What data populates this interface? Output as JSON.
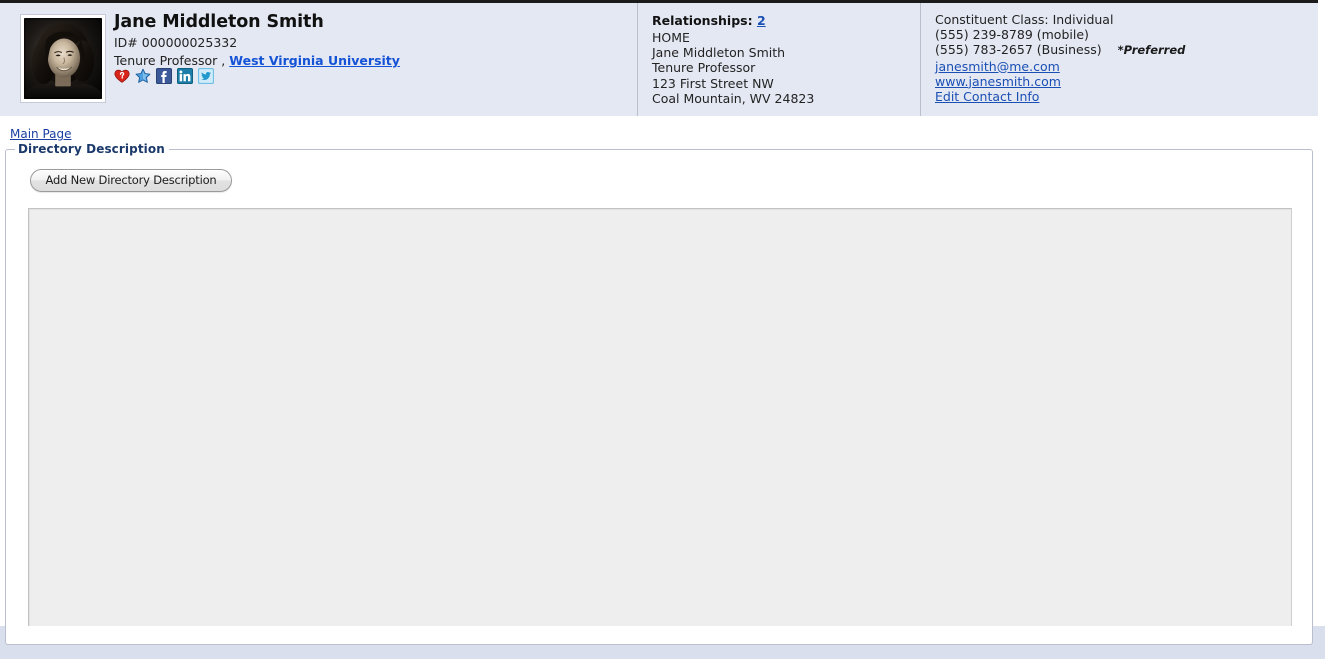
{
  "header": {
    "identity": {
      "avatar_alt": "constituent-portrait",
      "name": "Jane Middleton Smith",
      "id_label": "ID# 000000025332",
      "title": "Tenure Professor ,",
      "organization": "West Virginia University",
      "social_icons": [
        {
          "name": "heart-question-icon",
          "title": "Giving / Interest"
        },
        {
          "name": "star-icon",
          "title": "Favorite"
        },
        {
          "name": "facebook-icon",
          "title": "Facebook"
        },
        {
          "name": "linkedin-icon",
          "title": "LinkedIn"
        },
        {
          "name": "twitter-icon",
          "title": "Twitter"
        }
      ]
    },
    "relationships": {
      "heading_label": "Relationships:",
      "count": "2",
      "lines": [
        "HOME",
        "Jane Middleton Smith",
        "Tenure Professor",
        "123 First Street NW",
        "Coal Mountain, WV 24823"
      ]
    },
    "contact": {
      "constituent_class": "Constituent Class: Individual",
      "phone_mobile": "(555) 239-8789 (mobile)",
      "phone_business": "(555) 783-2657 (Business)",
      "preferred_tag": "*Preferred",
      "email": "janesmith@me.com",
      "website": "www.janesmith.com",
      "edit_link": "Edit Contact Info"
    }
  },
  "breadcrumb": {
    "main_page": "Main Page"
  },
  "directory_section": {
    "legend": "Directory Description",
    "add_button_label": "Add New Directory Description",
    "textarea_value": "",
    "textarea_placeholder": ""
  },
  "colors": {
    "header_background": "#e4e8f3",
    "link": "#1a4fb4",
    "legend": "#1b3a6b",
    "footer_band": "#d9dfec",
    "textarea_background": "#eeeeee"
  }
}
